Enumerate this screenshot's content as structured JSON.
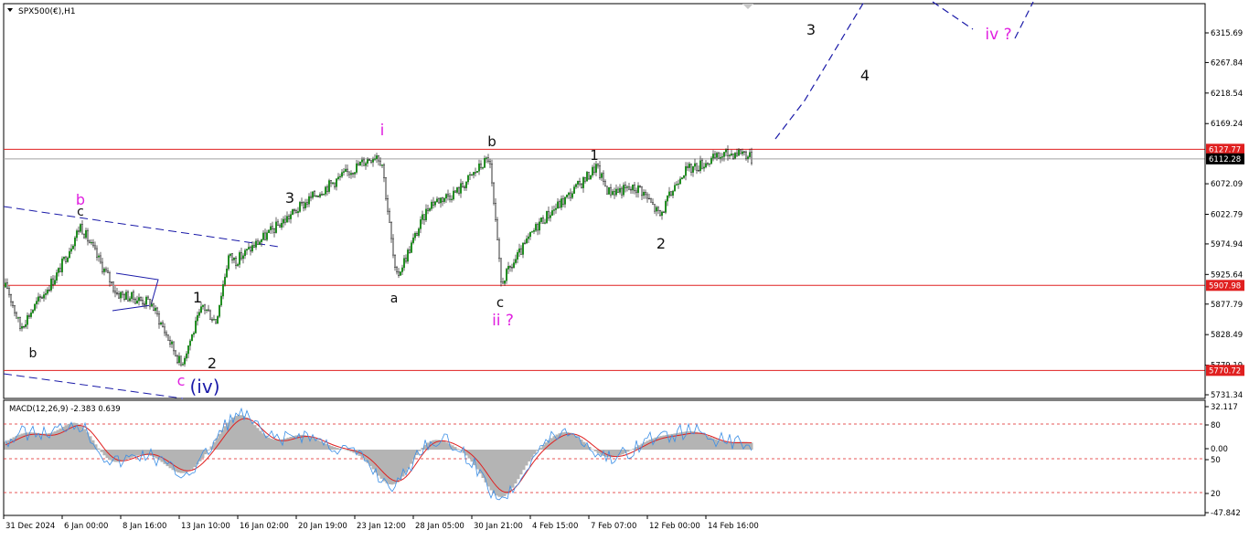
{
  "symbol_title": "SPX500(€),H1",
  "colors": {
    "candle": "#1a8a1a",
    "level_line": "#e02020",
    "current_line": "#a0a0a0",
    "channel": "#1a1aa8",
    "projection": "#1a1aa8",
    "macd_hist": "#b4b4b4",
    "macd_signal": "#e02020",
    "macd_line": "#3a8ee6",
    "label_black": "#111111",
    "label_magenta": "#e020e0",
    "label_blue": "#1a1aa8"
  },
  "price_axis": {
    "ticks": [
      "6315.69",
      "6267.84",
      "6218.54",
      "6169.24",
      "6072.09",
      "6022.79",
      "5974.94",
      "5925.64",
      "5877.79",
      "5828.49",
      "5779.19",
      "5731.34"
    ],
    "level_labels": [
      {
        "value": "6127.77",
        "color": "#e02020",
        "text_color": "#ffffff"
      },
      {
        "value": "6112.28",
        "color": "#000000",
        "text_color": "#ffffff"
      },
      {
        "value": "5907.98",
        "color": "#e02020",
        "text_color": "#ffffff"
      },
      {
        "value": "5770.72",
        "color": "#e02020",
        "text_color": "#ffffff"
      }
    ]
  },
  "time_axis": [
    "31 Dec 2024",
    "6 Jan 00:00",
    "8 Jan 16:00",
    "13 Jan 10:00",
    "16 Jan 02:00",
    "20 Jan 19:00",
    "23 Jan 12:00",
    "28 Jan 05:00",
    "30 Jan 21:00",
    "4 Feb 15:00",
    "7 Feb 07:00",
    "12 Feb 00:00",
    "14 Feb 16:00"
  ],
  "macd": {
    "title": "MACD(12,26,9) -2.383 0.639",
    "ticks": [
      "32.117",
      "80",
      "0.00",
      "50",
      "20",
      "-47.842"
    ]
  },
  "wave_labels": [
    {
      "text": "b",
      "color": "magenta"
    },
    {
      "text": "c",
      "color": "black"
    },
    {
      "text": "b",
      "color": "black"
    },
    {
      "text": "c",
      "color": "magenta"
    },
    {
      "text": "(iv)",
      "color": "blue"
    },
    {
      "text": "1",
      "color": "black"
    },
    {
      "text": "2",
      "color": "black"
    },
    {
      "text": "3",
      "color": "black"
    },
    {
      "text": "i",
      "color": "magenta"
    },
    {
      "text": "a",
      "color": "black"
    },
    {
      "text": "b",
      "color": "black"
    },
    {
      "text": "c",
      "color": "black"
    },
    {
      "text": "ii ?",
      "color": "magenta"
    },
    {
      "text": "1",
      "color": "black"
    },
    {
      "text": "2",
      "color": "black"
    },
    {
      "text": "3",
      "color": "black"
    },
    {
      "text": "4",
      "color": "black"
    },
    {
      "text": "iv ?",
      "color": "magenta"
    }
  ],
  "chart_data": {
    "type": "candlestick",
    "title": "SPX500(€),H1",
    "ylim": [
      5731.34,
      6355
    ],
    "key_levels": [
      6127.77,
      5907.98,
      5770.72
    ],
    "current_price": 6112.28,
    "approx_close_path": [
      {
        "x": "31 Dec 2024",
        "y": 5905
      },
      {
        "x": "2 Jan",
        "y": 5840
      },
      {
        "x": "3 Jan",
        "y": 5930
      },
      {
        "x": "6 Jan 00:00",
        "y": 6005
      },
      {
        "x": "7 Jan",
        "y": 5960
      },
      {
        "x": "8 Jan 16:00",
        "y": 5895
      },
      {
        "x": "10 Jan",
        "y": 5880
      },
      {
        "x": "13 Jan 10:00",
        "y": 5780
      },
      {
        "x": "14 Jan",
        "y": 5875
      },
      {
        "x": "15 Jan",
        "y": 5850
      },
      {
        "x": "16 Jan 02:00",
        "y": 5955
      },
      {
        "x": "17 Jan",
        "y": 5948
      },
      {
        "x": "20 Jan 19:00",
        "y": 6055
      },
      {
        "x": "22 Jan",
        "y": 6105
      },
      {
        "x": "23 Jan 12:00",
        "y": 6120
      },
      {
        "x": "24 Jan",
        "y": 6105
      },
      {
        "x": "27 Jan",
        "y": 5918
      },
      {
        "x": "28 Jan 05:00",
        "y": 6040
      },
      {
        "x": "29 Jan",
        "y": 6060
      },
      {
        "x": "30 Jan",
        "y": 6115
      },
      {
        "x": "30 Jan 21:00",
        "y": 5912
      },
      {
        "x": "3 Feb",
        "y": 6010
      },
      {
        "x": "4 Feb 15:00",
        "y": 6050
      },
      {
        "x": "6 Feb",
        "y": 6080
      },
      {
        "x": "7 Feb 07:00",
        "y": 6100
      },
      {
        "x": "10 Feb",
        "y": 6060
      },
      {
        "x": "11 Feb",
        "y": 6065
      },
      {
        "x": "12 Feb 00:00",
        "y": 6020
      },
      {
        "x": "13 Feb",
        "y": 6090
      },
      {
        "x": "14 Feb 16:00",
        "y": 6118
      },
      {
        "x": "18 Feb",
        "y": 6125
      },
      {
        "x": "19 Feb",
        "y": 6112.28
      }
    ],
    "macd_ylim": [
      -47.842,
      32.117
    ]
  }
}
